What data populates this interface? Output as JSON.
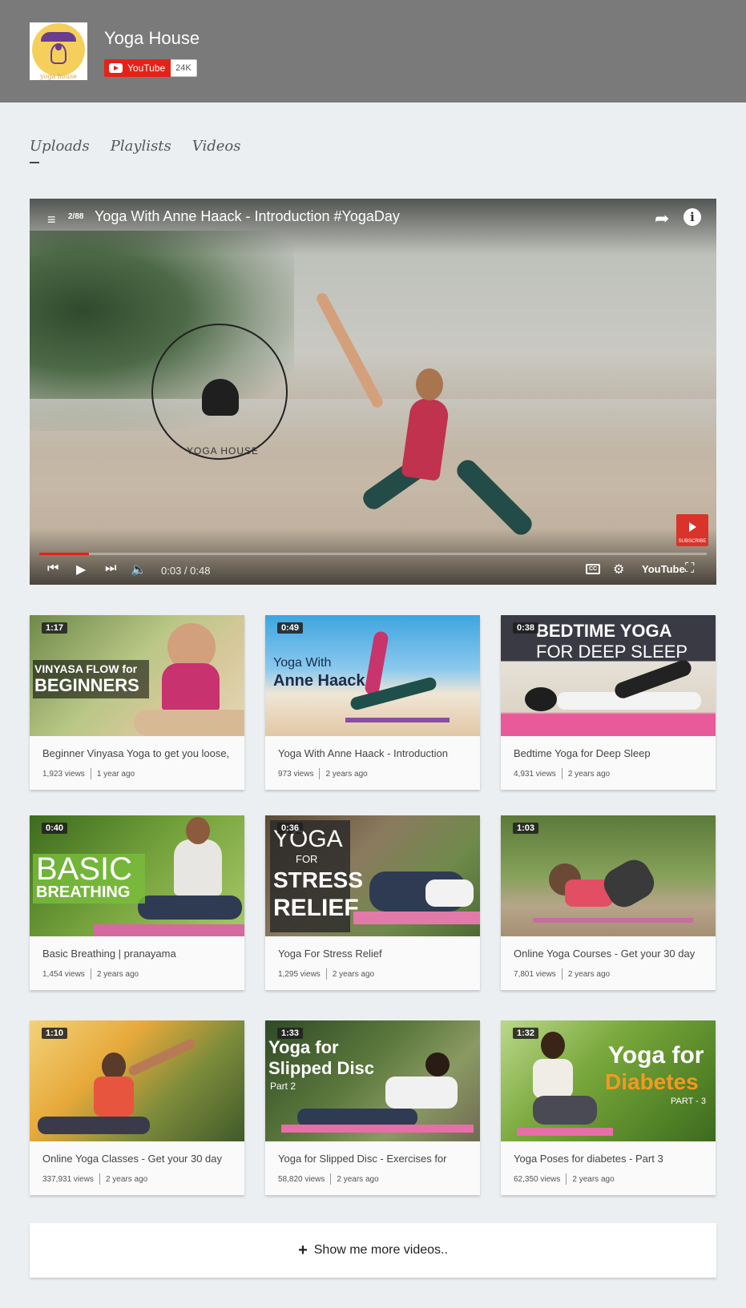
{
  "channel": {
    "title": "Yoga House",
    "logo_text": "yoga house",
    "youtube_label": "YouTube",
    "subscriber_count": "24K"
  },
  "tabs": [
    {
      "label": "Uploads",
      "active": true
    },
    {
      "label": "Playlists",
      "active": false
    },
    {
      "label": "Videos",
      "active": false
    }
  ],
  "player": {
    "playlist_position": "2/88",
    "title": "Yoga With Anne Haack - Introduction #YogaDay",
    "watermark_text": "YOGA HOUSE",
    "subscribe_label": "SUBSCRIBE",
    "time": "0:03 / 0:48",
    "progress_fraction": 0.075,
    "cc_label": "CC",
    "youtube_logo": "YouTube"
  },
  "videos": [
    {
      "duration": "1:17",
      "thumb_text": [
        "VINYASA FLOW for",
        "BEGINNERS"
      ],
      "title": "Beginner Vinyasa Yoga to get you loose,",
      "views": "1,923 views",
      "age": "1 year ago"
    },
    {
      "duration": "0:49",
      "thumb_text": [
        "Yoga With",
        "Anne Haack"
      ],
      "title": "Yoga With Anne Haack - Introduction",
      "views": "973 views",
      "age": "2 years ago"
    },
    {
      "duration": "0:38",
      "thumb_text": [
        "BEDTIME YOGA",
        "FOR DEEP SLEEP"
      ],
      "title": "Bedtime Yoga for Deep Sleep",
      "views": "4,931 views",
      "age": "2 years ago"
    },
    {
      "duration": "0:40",
      "thumb_text": [
        "BASIC",
        "BREATHING"
      ],
      "title": "Basic Breathing | pranayama",
      "views": "1,454 views",
      "age": "2 years ago"
    },
    {
      "duration": "0:36",
      "thumb_text": [
        "YOGA",
        "FOR",
        "STRESS",
        "RELIEF"
      ],
      "title": "Yoga For Stress Relief",
      "views": "1,295 views",
      "age": "2 years ago"
    },
    {
      "duration": "1:03",
      "thumb_text": [],
      "title": "Online Yoga Courses - Get your 30 day",
      "views": "7,801 views",
      "age": "2 years ago"
    },
    {
      "duration": "1:10",
      "thumb_text": [],
      "title": "Online Yoga Classes - Get your 30 day",
      "views": "337,931 views",
      "age": "2 years ago"
    },
    {
      "duration": "1:33",
      "thumb_text": [
        "Yoga for",
        "Slipped Disc",
        "Part 2"
      ],
      "title": "Yoga for Slipped Disc - Exercises for",
      "views": "58,820 views",
      "age": "2 years ago"
    },
    {
      "duration": "1:32",
      "thumb_text": [
        "Yoga for",
        "Diabetes",
        "PART - 3"
      ],
      "title": "Yoga Poses for diabetes - Part 3",
      "views": "62,350 views",
      "age": "2 years ago"
    }
  ],
  "more_button": {
    "label": "Show me more videos.."
  },
  "colors": {
    "header_bg": "#7a7a7a",
    "page_bg": "#eceff1",
    "youtube_red": "#e62117"
  }
}
